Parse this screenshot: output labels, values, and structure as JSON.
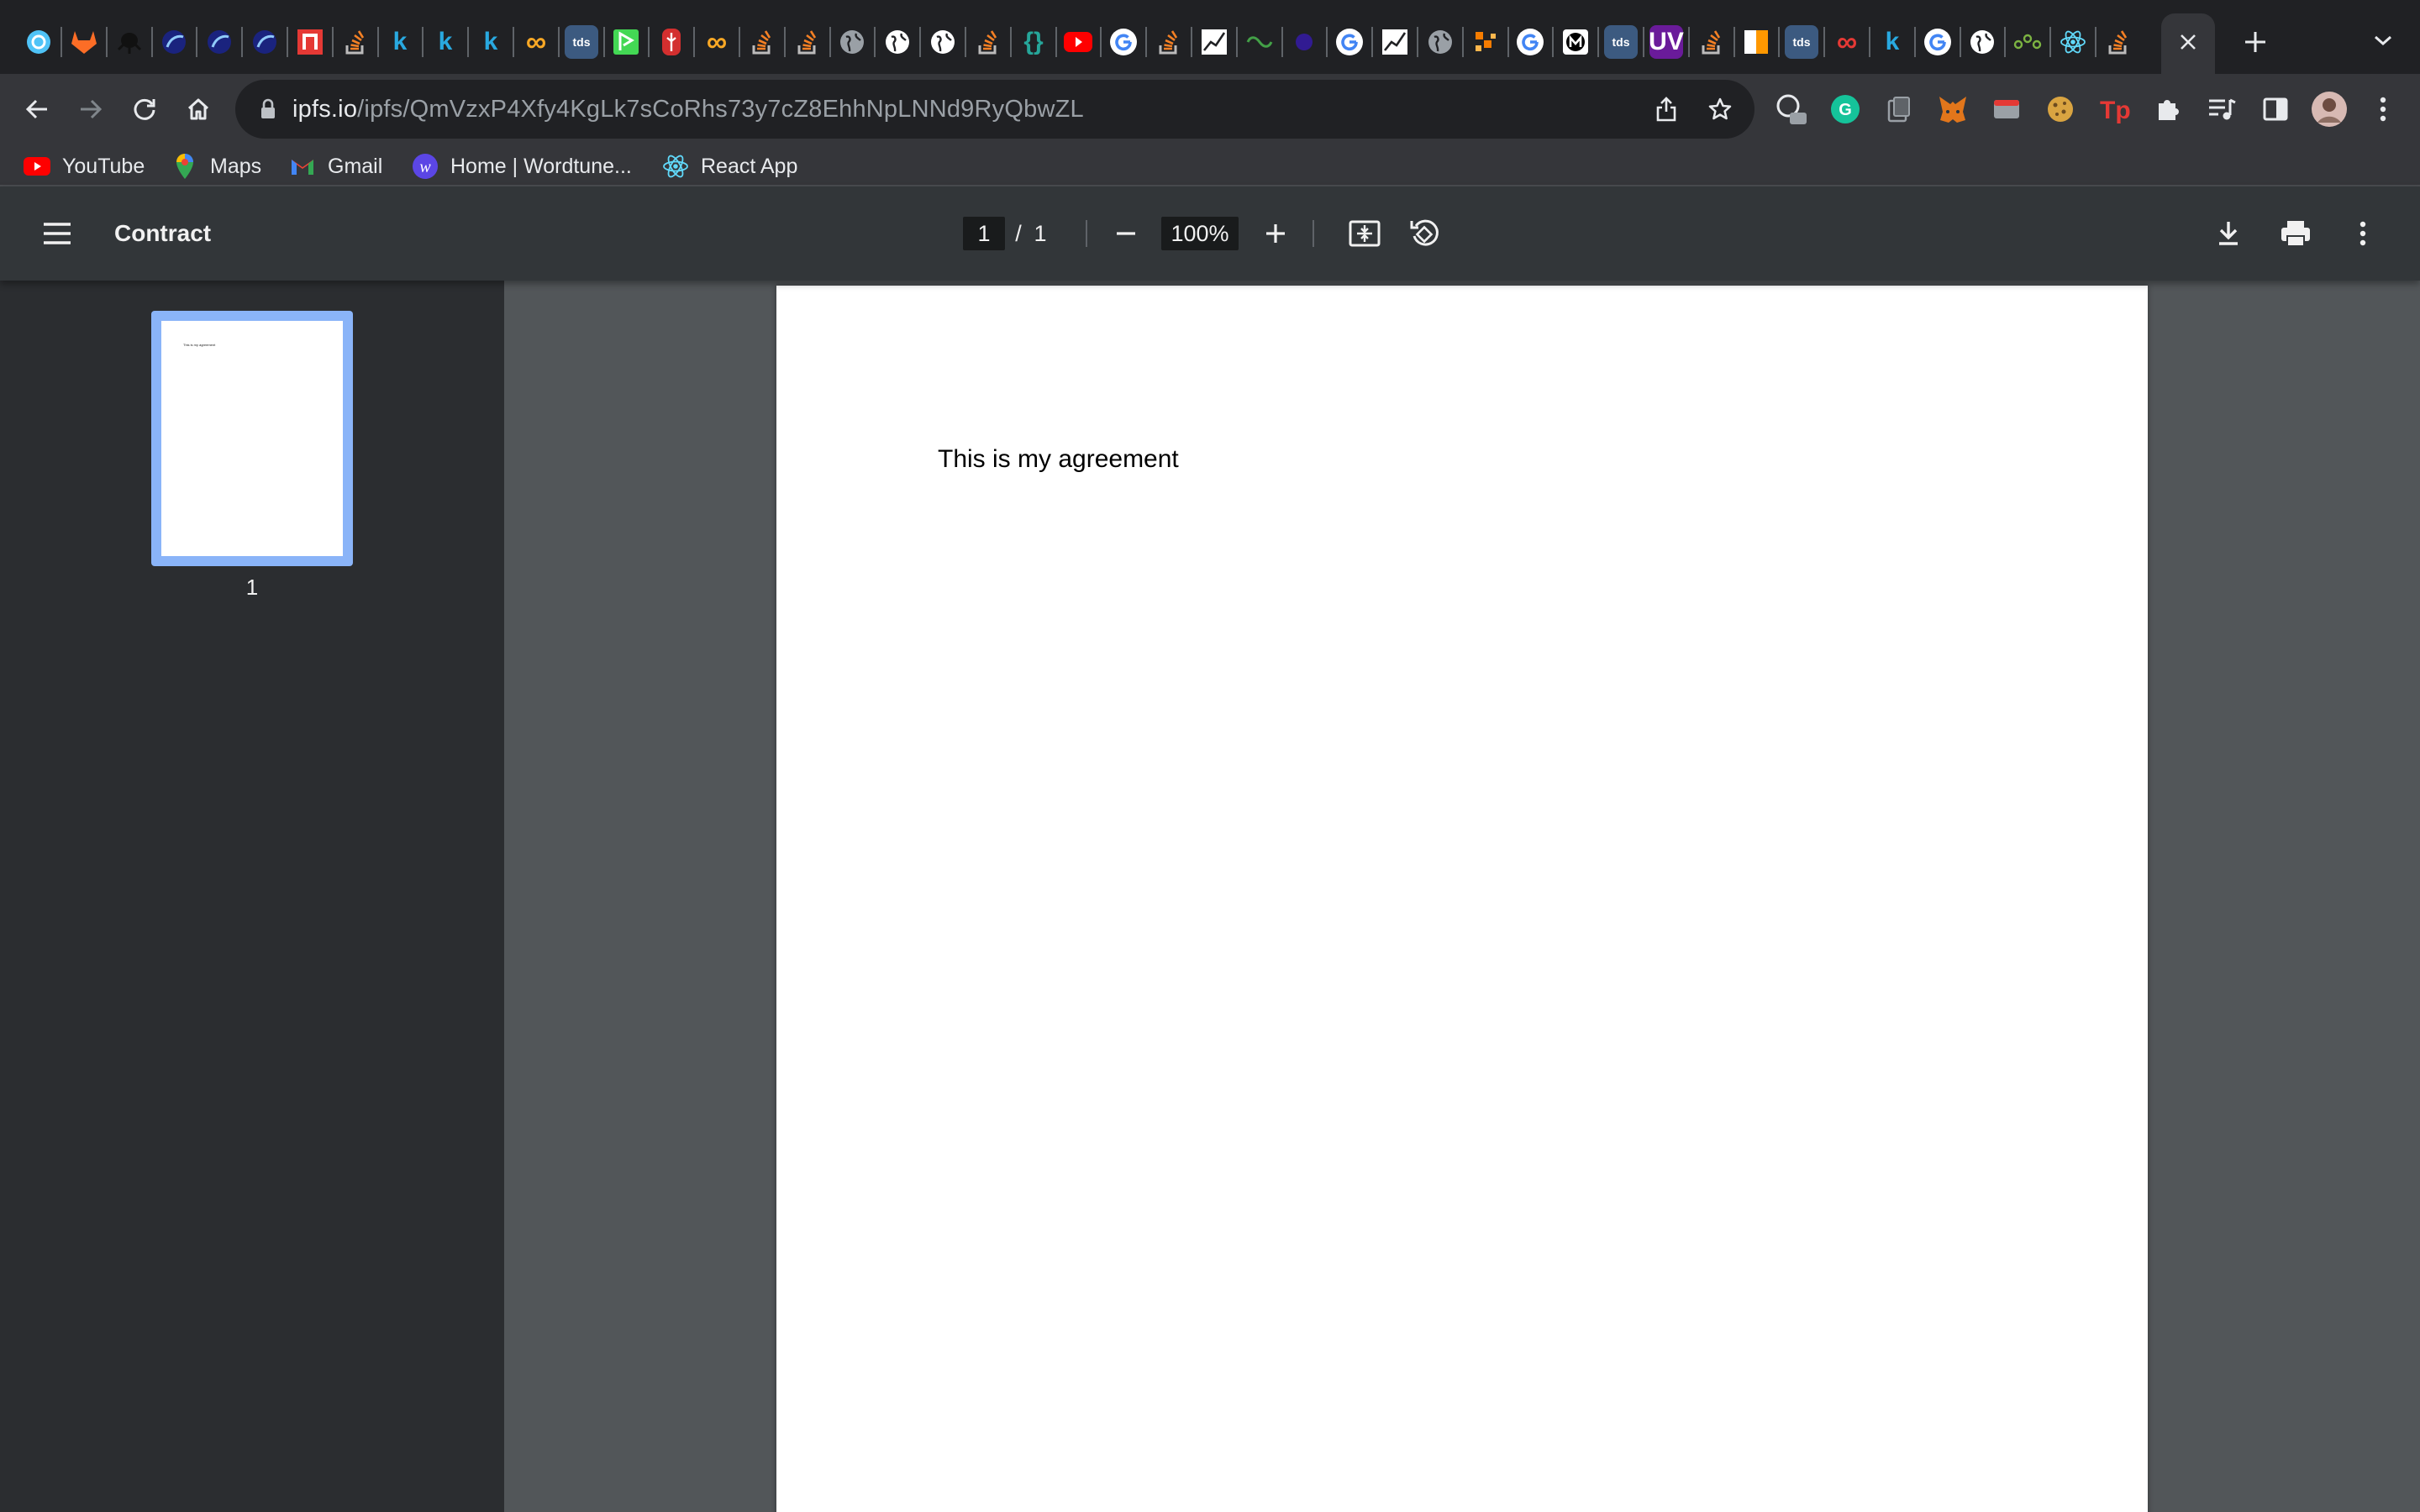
{
  "browser": {
    "url_host": "ipfs.io",
    "url_path": "/ipfs/QmVzxP4Xfy4KgLk7sCoRhs73y7cZ8EhhNpLNNd9RyQbwZL",
    "colors": {
      "tabstrip": "#202124",
      "toolbar": "#35363a",
      "omnibox": "#202124",
      "pdf_toolbar": "#323639",
      "pdf_sidebar": "#2b2d30",
      "pdf_canvas": "#525659",
      "thumb_highlight": "#8ab4f8"
    },
    "tab_icons": [
      {
        "name": "tab-favicon-sync",
        "color": "#4fc3f7"
      },
      {
        "name": "tab-favicon-gitlab",
        "color": "#fc6d26"
      },
      {
        "name": "tab-favicon-octopus",
        "color": "#000000"
      },
      {
        "name": "tab-favicon-moon",
        "color": "#5c6bc0"
      },
      {
        "name": "tab-favicon-moon",
        "color": "#5c6bc0"
      },
      {
        "name": "tab-favicon-moon",
        "color": "#3949ab"
      },
      {
        "name": "tab-favicon-n",
        "color": "#e53935"
      },
      {
        "name": "tab-favicon-stackoverflow",
        "color": "#f48024"
      },
      {
        "name": "tab-favicon-k",
        "color": "#29a9e0"
      },
      {
        "name": "tab-favicon-k",
        "color": "#29a9e0"
      },
      {
        "name": "tab-favicon-k",
        "color": "#29a9e0"
      },
      {
        "name": "tab-favicon-infinity",
        "color": "#f9a825"
      },
      {
        "name": "tab-favicon-tds",
        "color": "#3c5a80"
      },
      {
        "name": "tab-favicon-green",
        "color": "#43d854"
      },
      {
        "name": "tab-favicon-red",
        "color": "#d32f2f"
      },
      {
        "name": "tab-favicon-infinity",
        "color": "#f9a825"
      },
      {
        "name": "tab-favicon-stackoverflow",
        "color": "#f48024"
      },
      {
        "name": "tab-favicon-stackoverflow",
        "color": "#f48024"
      },
      {
        "name": "tab-favicon-globe",
        "color": "#9aa0a6"
      },
      {
        "name": "tab-favicon-globe",
        "color": "#ffffff"
      },
      {
        "name": "tab-favicon-globe",
        "color": "#ffffff"
      },
      {
        "name": "tab-favicon-stackoverflow",
        "color": "#f48024"
      },
      {
        "name": "tab-favicon-braces",
        "color": "#26a69a"
      },
      {
        "name": "tab-favicon-youtube",
        "color": "#ff0000"
      },
      {
        "name": "tab-favicon-google",
        "color": "#ffffff"
      },
      {
        "name": "tab-favicon-stackoverflow",
        "color": "#f48024"
      },
      {
        "name": "tab-favicon-chart",
        "color": "#ffffff"
      },
      {
        "name": "tab-favicon-link",
        "color": "#43a047"
      },
      {
        "name": "tab-favicon-dark",
        "color": "#311b92"
      },
      {
        "name": "tab-favicon-google",
        "color": "#ffffff"
      },
      {
        "name": "tab-favicon-chart",
        "color": "#ffffff"
      },
      {
        "name": "tab-favicon-globe",
        "color": "#9aa0a6"
      },
      {
        "name": "tab-favicon-blocks",
        "color": "#f57c00"
      },
      {
        "name": "tab-favicon-google",
        "color": "#ffffff"
      },
      {
        "name": "tab-favicon-m",
        "color": "#ffffff"
      },
      {
        "name": "tab-favicon-tds",
        "color": "#3c5a80"
      },
      {
        "name": "tab-favicon-uv",
        "color": "#6a1b9a"
      },
      {
        "name": "tab-favicon-stackoverflow",
        "color": "#f48024"
      },
      {
        "name": "tab-favicon-flag",
        "color": "#ff9800"
      },
      {
        "name": "tab-favicon-tds",
        "color": "#3c5a80"
      },
      {
        "name": "tab-favicon-infinity",
        "color": "#e53935"
      },
      {
        "name": "tab-favicon-k",
        "color": "#29a9e0"
      },
      {
        "name": "tab-favicon-google",
        "color": "#ffffff"
      },
      {
        "name": "tab-favicon-globe",
        "color": "#ffffff"
      },
      {
        "name": "tab-favicon-nodes",
        "color": "#7cb342"
      },
      {
        "name": "tab-favicon-react",
        "color": "#61dafb"
      },
      {
        "name": "tab-favicon-stackoverflow",
        "color": "#f48024"
      }
    ],
    "tab_letters": {
      "k": "k",
      "tds": "tds",
      "uv": "UV",
      "braces": "{}",
      "infinity": "∞"
    }
  },
  "bookmarks": [
    {
      "label": "YouTube",
      "icon": "youtube-icon"
    },
    {
      "label": "Maps",
      "icon": "maps-icon"
    },
    {
      "label": "Gmail",
      "icon": "gmail-icon"
    },
    {
      "label": "Home | Wordtune...",
      "icon": "wordtune-icon"
    },
    {
      "label": "React App",
      "icon": "react-icon"
    }
  ],
  "pdf": {
    "title": "Contract",
    "current_page": "1",
    "page_separator": "/",
    "total_pages": "1",
    "zoom": "100%",
    "thumbnail_label": "1",
    "thumbnail_text": "This is my agreement",
    "page_text": "This is my agreement"
  }
}
